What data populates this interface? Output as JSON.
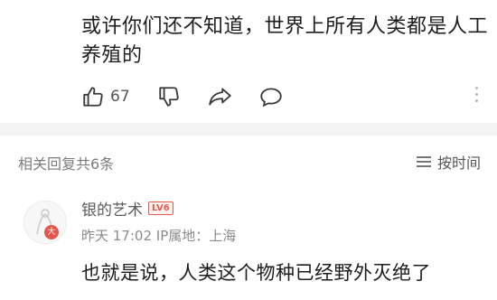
{
  "post": {
    "text": "或许你们还不知道，世界上所有人类都是人工养殖的",
    "likes": "67"
  },
  "replies": {
    "header": "相关回复共6条",
    "sort_label": "按时间"
  },
  "reply": {
    "username": "银的艺术",
    "level": "LV6",
    "avatar_badge": "大",
    "meta": "昨天 17:02 IP属地：上海",
    "text": "也就是说，人类这个物种已经野外灭绝了"
  },
  "colors": {
    "badge_red": "#e8584f",
    "divider_gray": "#f3f3f3"
  }
}
